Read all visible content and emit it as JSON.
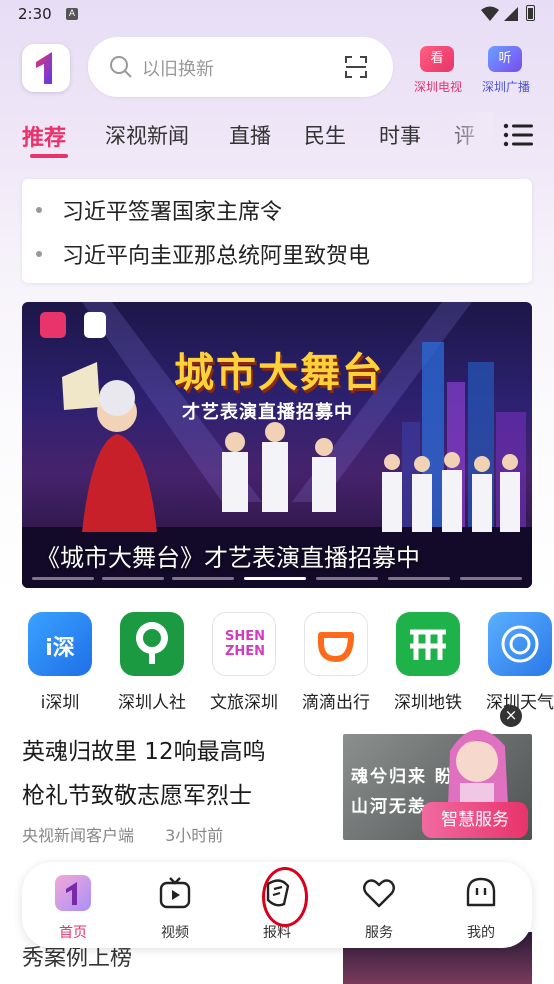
{
  "status_bar": {
    "time": "2:30",
    "notification_icon": "A"
  },
  "header": {
    "search_placeholder": "以旧换新",
    "tv": {
      "badge": "看",
      "label": "深圳电视"
    },
    "radio": {
      "badge": "听",
      "label": "深圳广播"
    }
  },
  "tabs": [
    {
      "label": "推荐",
      "active": true
    },
    {
      "label": "深视新闻"
    },
    {
      "label": "直播"
    },
    {
      "label": "民生"
    },
    {
      "label": "时事"
    },
    {
      "label": "评"
    }
  ],
  "headlines": [
    "习近平签署国家主席令",
    "习近平向圭亚那总统阿里致贺电"
  ],
  "banner": {
    "title": "城市大舞台",
    "subtitle": "才艺表演直播招募中",
    "caption": "《城市大舞台》才艺表演直播招募中",
    "active_page": 4
  },
  "apps": [
    {
      "label": "i深圳",
      "glyph": "i深",
      "icon": "i-shenzhen-icon"
    },
    {
      "label": "深圳人社",
      "glyph": "",
      "icon": "tree-icon"
    },
    {
      "label": "文旅深圳",
      "glyph": "SHEN ZHEN",
      "icon": "shenzhen-logo-icon"
    },
    {
      "label": "滴滴出行",
      "glyph": "",
      "icon": "didi-icon"
    },
    {
      "label": "深圳地铁",
      "glyph": "",
      "icon": "metro-icon"
    },
    {
      "label": "深圳天气",
      "glyph": "",
      "icon": "weather-icon"
    }
  ],
  "article": {
    "title_line1": "英魂归故里 12响最高鸣",
    "title_line2": "枪礼节致敬志愿军烈士",
    "source": "央视新闻客户端",
    "time": "3小时前",
    "thumb_line1": "魂兮归来 盼",
    "thumb_line2": "山河无恙"
  },
  "assistant": {
    "close": "×",
    "label": "智慧服务"
  },
  "behind_text": "秀案例上榜",
  "bottom_nav": [
    {
      "label": "首页",
      "icon": "home-logo-icon",
      "active": true
    },
    {
      "label": "视频",
      "icon": "video-icon"
    },
    {
      "label": "报料",
      "icon": "report-icon"
    },
    {
      "label": "服务",
      "icon": "heart-icon"
    },
    {
      "label": "我的",
      "icon": "profile-icon"
    }
  ],
  "colors": {
    "accent": "#e8336b",
    "annotation": "#d8001a"
  }
}
